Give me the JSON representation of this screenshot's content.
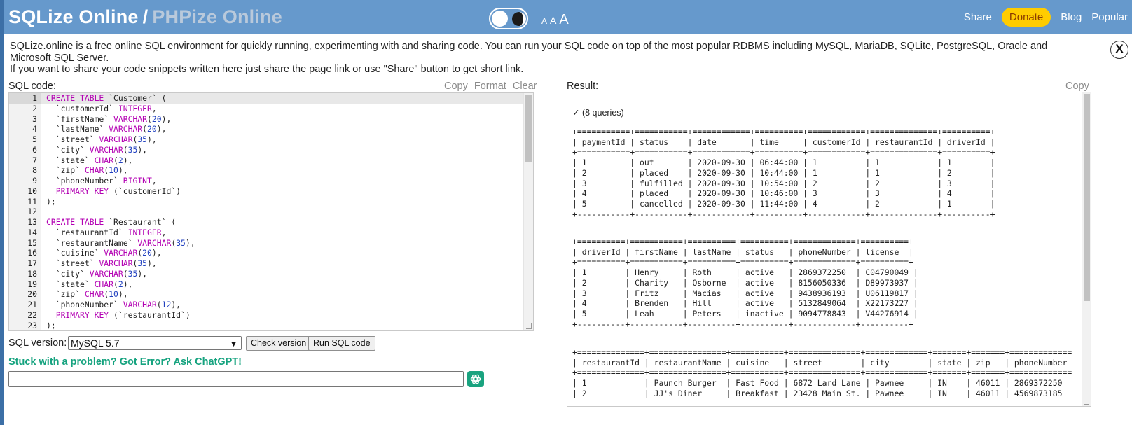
{
  "header": {
    "brand_main": "SQLize Online",
    "brand_sep": "/",
    "brand_alt": "PHPize Online",
    "font_sizes": [
      "A",
      "A",
      "A"
    ],
    "nav": {
      "share": "Share",
      "donate": "Donate",
      "blog": "Blog",
      "popular": "Popular"
    }
  },
  "intro": {
    "line1": "SQLize.online is a free online SQL environment for quickly running, experimenting with and sharing code. You can run your SQL code on top of the most popular RDBMS including MySQL, MariaDB, SQLite, PostgreSQL, Oracle and Microsoft SQL Server.",
    "line2": "If you want to share your code snippets written here just share the page link or use \"Share\" button to get short link.",
    "close": "X"
  },
  "editor": {
    "label": "SQL code:",
    "links": {
      "copy": "Copy",
      "format": "Format",
      "clear": "Clear"
    },
    "lines": [
      [
        {
          "t": "CREATE TABLE",
          "c": "k"
        },
        {
          "t": " `Customer` ("
        }
      ],
      [
        {
          "t": "  `customerId` "
        },
        {
          "t": "INTEGER",
          "c": "k"
        },
        {
          "t": ","
        }
      ],
      [
        {
          "t": "  `firstName` "
        },
        {
          "t": "VARCHAR",
          "c": "k"
        },
        {
          "t": "("
        },
        {
          "t": "20",
          "c": "n"
        },
        {
          "t": "),"
        }
      ],
      [
        {
          "t": "  `lastName` "
        },
        {
          "t": "VARCHAR",
          "c": "k"
        },
        {
          "t": "("
        },
        {
          "t": "20",
          "c": "n"
        },
        {
          "t": "),"
        }
      ],
      [
        {
          "t": "  `street` "
        },
        {
          "t": "VARCHAR",
          "c": "k"
        },
        {
          "t": "("
        },
        {
          "t": "35",
          "c": "n"
        },
        {
          "t": "),"
        }
      ],
      [
        {
          "t": "  `city` "
        },
        {
          "t": "VARCHAR",
          "c": "k"
        },
        {
          "t": "("
        },
        {
          "t": "35",
          "c": "n"
        },
        {
          "t": "),"
        }
      ],
      [
        {
          "t": "  `state` "
        },
        {
          "t": "CHAR",
          "c": "k"
        },
        {
          "t": "("
        },
        {
          "t": "2",
          "c": "n"
        },
        {
          "t": "),"
        }
      ],
      [
        {
          "t": "  `zip` "
        },
        {
          "t": "CHAR",
          "c": "k"
        },
        {
          "t": "("
        },
        {
          "t": "10",
          "c": "n"
        },
        {
          "t": "),"
        }
      ],
      [
        {
          "t": "  `phoneNumber` "
        },
        {
          "t": "BIGINT",
          "c": "k"
        },
        {
          "t": ","
        }
      ],
      [
        {
          "t": "  "
        },
        {
          "t": "PRIMARY KEY",
          "c": "k"
        },
        {
          "t": " (`customerId`)"
        }
      ],
      [
        {
          "t": ");"
        }
      ],
      [],
      [
        {
          "t": "CREATE TABLE",
          "c": "k"
        },
        {
          "t": " `Restaurant` ("
        }
      ],
      [
        {
          "t": "  `restaurantId` "
        },
        {
          "t": "INTEGER",
          "c": "k"
        },
        {
          "t": ","
        }
      ],
      [
        {
          "t": "  `restaurantName` "
        },
        {
          "t": "VARCHAR",
          "c": "k"
        },
        {
          "t": "("
        },
        {
          "t": "35",
          "c": "n"
        },
        {
          "t": "),"
        }
      ],
      [
        {
          "t": "  `cuisine` "
        },
        {
          "t": "VARCHAR",
          "c": "k"
        },
        {
          "t": "("
        },
        {
          "t": "20",
          "c": "n"
        },
        {
          "t": "),"
        }
      ],
      [
        {
          "t": "  `street` "
        },
        {
          "t": "VARCHAR",
          "c": "k"
        },
        {
          "t": "("
        },
        {
          "t": "35",
          "c": "n"
        },
        {
          "t": "),"
        }
      ],
      [
        {
          "t": "  `city` "
        },
        {
          "t": "VARCHAR",
          "c": "k"
        },
        {
          "t": "("
        },
        {
          "t": "35",
          "c": "n"
        },
        {
          "t": "),"
        }
      ],
      [
        {
          "t": "  `state` "
        },
        {
          "t": "CHAR",
          "c": "k"
        },
        {
          "t": "("
        },
        {
          "t": "2",
          "c": "n"
        },
        {
          "t": "),"
        }
      ],
      [
        {
          "t": "  `zip` "
        },
        {
          "t": "CHAR",
          "c": "k"
        },
        {
          "t": "("
        },
        {
          "t": "10",
          "c": "n"
        },
        {
          "t": "),"
        }
      ],
      [
        {
          "t": "  `phoneNumber` "
        },
        {
          "t": "VARCHAR",
          "c": "k"
        },
        {
          "t": "("
        },
        {
          "t": "12",
          "c": "n"
        },
        {
          "t": "),"
        }
      ],
      [
        {
          "t": "  "
        },
        {
          "t": "PRIMARY KEY",
          "c": "k"
        },
        {
          "t": " (`restaurantId`)"
        }
      ],
      [
        {
          "t": ");"
        }
      ]
    ]
  },
  "controls": {
    "version_label": "SQL version:",
    "version_selected": "MySQL 5.7",
    "check_version": "Check version",
    "run": "Run SQL code",
    "chatgpt_title": "Stuck with a problem? Got Error? Ask ChatGPT!"
  },
  "result": {
    "label": "Result:",
    "copy": "Copy",
    "queries": "✓ (8 queries)",
    "blocks": [
      "+===========+===========+============+==========+============+==============+==========+\n| paymentId | status    | date       | time     | customerId | restaurantId | driverId |\n+===========+===========+============+==========+============+==============+==========+\n| 1         | out       | 2020-09-30 | 06:44:00 | 1          | 1            | 1        |\n| 2         | placed    | 2020-09-30 | 10:44:00 | 1          | 1            | 2        |\n| 3         | fulfilled | 2020-09-30 | 10:54:00 | 2          | 2            | 3        |\n| 4         | placed    | 2020-09-30 | 10:46:00 | 3          | 3            | 4        |\n| 5         | cancelled | 2020-09-30 | 11:44:00 | 4          | 2            | 1        |\n+-----------+-----------+------------+----------+------------+--------------+----------+",
      "+==========+===========+==========+==========+=============+==========+\n| driverId | firstName | lastName | status   | phoneNumber | license  |\n+==========+===========+==========+==========+=============+==========+\n| 1        | Henry     | Roth     | active   | 2869372250  | C04790049 |\n| 2        | Charity   | Osborne  | active   | 8156050336  | D89973937 |\n| 3        | Fritz     | Macias   | active   | 9438936193  | U06119817 |\n| 4        | Brenden   | Hill     | active   | 5132849064  | X22173227 |\n| 5        | Leah      | Peters   | inactive | 9094778843  | V44276914 |\n+----------+-----------+----------+----------+-------------+----------+",
      "+==============+================+===========+===============+=============+=======+=======+=============\n| restaurantId | restaurantName | cuisine   | street        | city        | state | zip   | phoneNumber\n+==============+================+===========+===============+=============+=======+=======+=============\n| 1            | Paunch Burger  | Fast Food | 6872 Lard Lane | Pawnee     | IN    | 46011 | 2869372250\n| 2            | JJ's Diner     | Breakfast | 23428 Main St. | Pawnee     | IN    | 46011 | 4569873185"
    ]
  }
}
